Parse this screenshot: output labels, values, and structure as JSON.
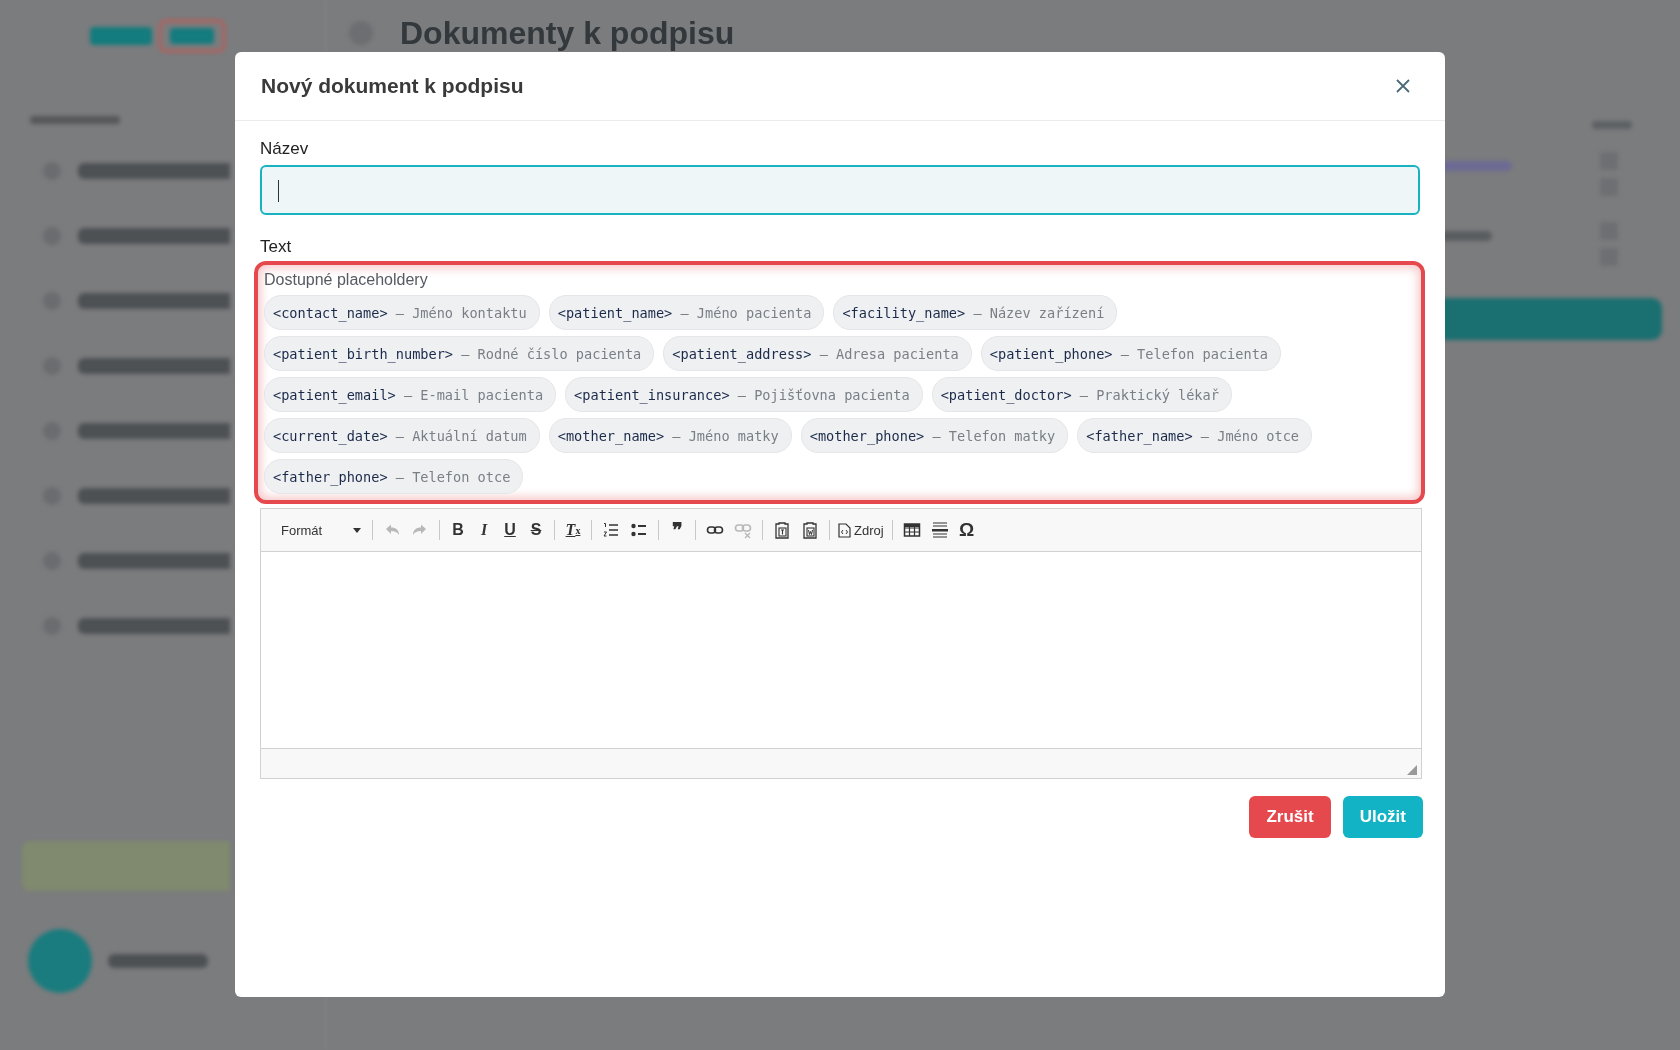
{
  "background": {
    "page_title": "Dokumenty k podpisu"
  },
  "modal": {
    "title": "Nový dokument k podpisu",
    "name_field": {
      "label": "Název",
      "focused": true
    },
    "text_label": "Text",
    "placeholders": {
      "heading": "Dostupné placeholdery",
      "highlighted": true,
      "items": [
        {
          "key": "<contact_name>",
          "description": "— Jméno kontaktu"
        },
        {
          "key": "<patient_name>",
          "description": "— Jméno pacienta"
        },
        {
          "key": "<facility_name>",
          "description": "— Název zařízení"
        },
        {
          "key": "<patient_birth_number>",
          "description": "— Rodné číslo pacienta"
        },
        {
          "key": "<patient_address>",
          "description": "— Adresa pacienta"
        },
        {
          "key": "<patient_phone>",
          "description": "— Telefon pacienta"
        },
        {
          "key": "<patient_email>",
          "description": "— E-mail pacienta"
        },
        {
          "key": "<patient_insurance>",
          "description": "— Pojišťovna pacienta"
        },
        {
          "key": "<patient_doctor>",
          "description": "— Praktický lékař"
        },
        {
          "key": "<current_date>",
          "description": "— Aktuální datum"
        },
        {
          "key": "<mother_name>",
          "description": "— Jméno matky"
        },
        {
          "key": "<mother_phone>",
          "description": "— Telefon matky"
        },
        {
          "key": "<father_name>",
          "description": "— Jméno otce"
        },
        {
          "key": "<father_phone>",
          "description": "— Telefon otce"
        }
      ]
    },
    "toolbar": [
      {
        "kind": "format",
        "label": "Formát"
      },
      {
        "kind": "separator"
      },
      {
        "kind": "undo",
        "disabled": true
      },
      {
        "kind": "redo",
        "disabled": true
      },
      {
        "kind": "separator"
      },
      {
        "kind": "bold",
        "label": "B",
        "disabled": false
      },
      {
        "kind": "italic",
        "label": "I",
        "disabled": false
      },
      {
        "kind": "underline",
        "label": "U",
        "disabled": false
      },
      {
        "kind": "strike",
        "label": "S",
        "disabled": false
      },
      {
        "kind": "separator"
      },
      {
        "kind": "clear",
        "label": "T",
        "sub": "x",
        "disabled": false
      },
      {
        "kind": "separator"
      },
      {
        "kind": "numbered",
        "disabled": false
      },
      {
        "kind": "bulleted",
        "disabled": false
      },
      {
        "kind": "separator"
      },
      {
        "kind": "quote",
        "label": "❞",
        "disabled": false
      },
      {
        "kind": "separator"
      },
      {
        "kind": "link",
        "disabled": false
      },
      {
        "kind": "unlink",
        "disabled": true
      },
      {
        "kind": "separator"
      },
      {
        "kind": "paste-text",
        "disabled": false
      },
      {
        "kind": "paste-word",
        "disabled": false
      },
      {
        "kind": "separator"
      },
      {
        "kind": "source",
        "label": "Zdroj",
        "disabled": false
      },
      {
        "kind": "separator"
      },
      {
        "kind": "table",
        "disabled": false
      },
      {
        "kind": "rule",
        "disabled": false
      },
      {
        "kind": "char",
        "label": "Ω",
        "disabled": false
      }
    ],
    "buttons": [
      {
        "kind": "cancel",
        "label": "Zrušit"
      },
      {
        "kind": "save",
        "label": "Uložit"
      }
    ]
  }
}
